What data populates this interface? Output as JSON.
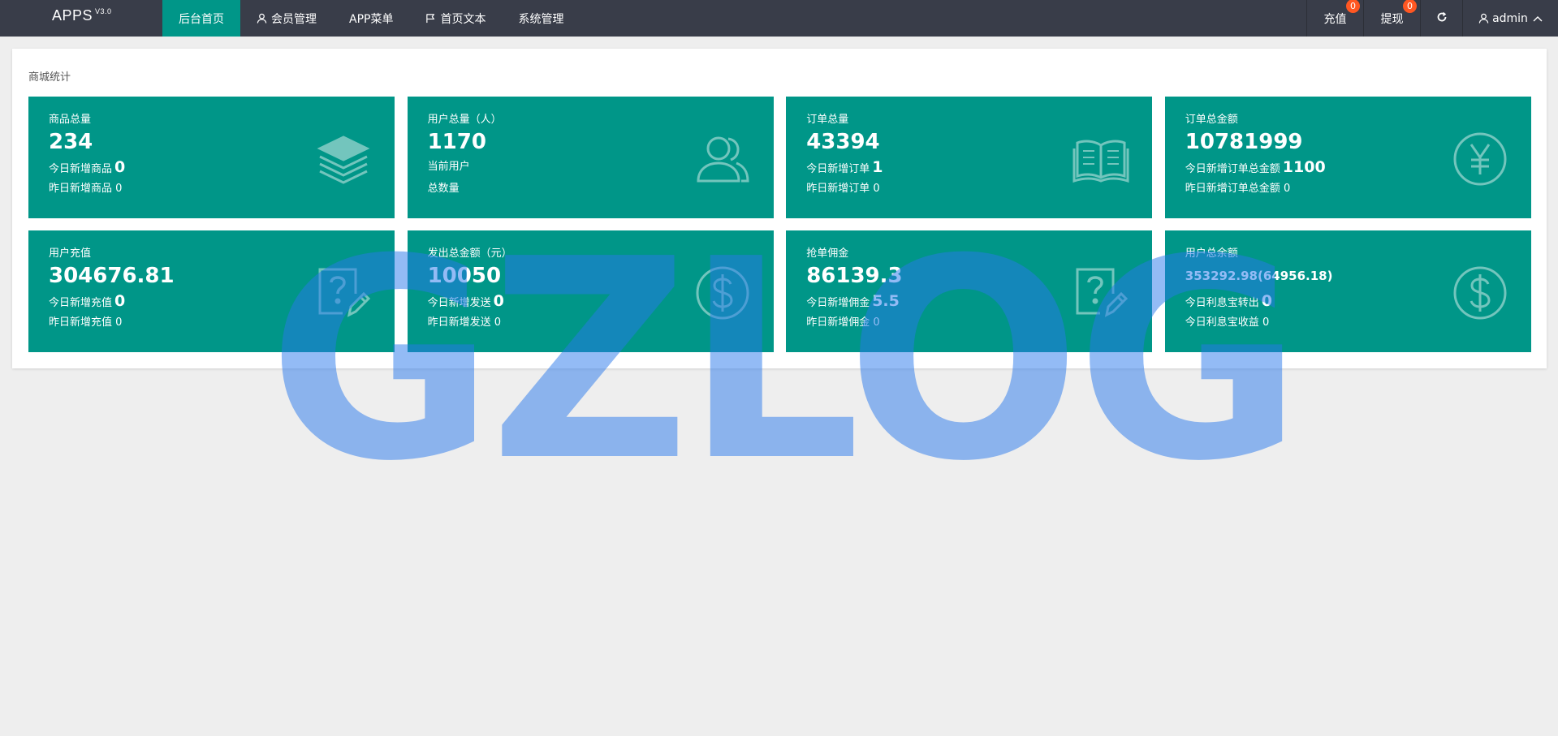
{
  "app": {
    "name": "APPS",
    "version": "V3.0"
  },
  "nav": [
    {
      "label": "后台首页",
      "icon": ""
    },
    {
      "label": "会员管理",
      "icon": "user-icon"
    },
    {
      "label": "APP菜单",
      "icon": ""
    },
    {
      "label": "首页文本",
      "icon": "flag-icon"
    },
    {
      "label": "系统管理",
      "icon": ""
    }
  ],
  "right_nav": {
    "recharge": {
      "label": "充值",
      "badge": "0"
    },
    "withdraw": {
      "label": "提现",
      "badge": "0"
    },
    "refresh_icon": "refresh-icon",
    "user": {
      "label": "admin",
      "icon": "user-icon"
    }
  },
  "panel": {
    "title": "商城统计"
  },
  "cards": [
    {
      "title": "商品总量",
      "value": "234",
      "line1_label": "今日新增商品",
      "line1_value": "0",
      "line2_label": "昨日新增商品",
      "line2_value": "0",
      "icon": "layers-icon"
    },
    {
      "title": "用户总量（人）",
      "value": "1170",
      "line1_label": "当前用户",
      "line1_value": "",
      "line2_label": "总数量",
      "line2_value": "",
      "icon": "users-icon"
    },
    {
      "title": "订单总量",
      "value": "43394",
      "line1_label": "今日新增订单",
      "line1_value": "1",
      "line2_label": "昨日新增订单",
      "line2_value": "0",
      "icon": "book-icon"
    },
    {
      "title": "订单总金额",
      "value": "10781999",
      "line1_label": "今日新增订单总金额",
      "line1_value": "1100",
      "line2_label": "昨日新增订单总金额",
      "line2_value": "0",
      "icon": "yen-icon"
    },
    {
      "title": "用户充值",
      "value": "304676.81",
      "line1_label": "今日新增充值",
      "line1_value": "0",
      "line2_label": "昨日新增充值",
      "line2_value": "0",
      "icon": "question-edit-icon"
    },
    {
      "title": "发出总金额（元）",
      "value": "10050",
      "line1_label": "今日新增发送",
      "line1_value": "0",
      "line2_label": "昨日新增发送",
      "line2_value": "0",
      "icon": "dollar-icon"
    },
    {
      "title": "抢单佣金",
      "value": "86139.3",
      "line1_label": "今日新增佣金",
      "line1_value": "5.5",
      "line2_label": "昨日新增佣金",
      "line2_value": "0",
      "icon": "question-edit-icon"
    },
    {
      "title": "用户总余额",
      "value": "353292.98(64956.18)",
      "line1_label": "今日利息宝转出",
      "line1_value": "0",
      "line2_label": "今日利息宝收益",
      "line2_value": "0",
      "icon": "dollar-icon"
    }
  ],
  "watermark": {
    "text": "GZLOG"
  },
  "colors": {
    "topbar": "#393d49",
    "accent": "#009688",
    "badge": "#ff5722",
    "page_bg": "#eeeeee"
  }
}
